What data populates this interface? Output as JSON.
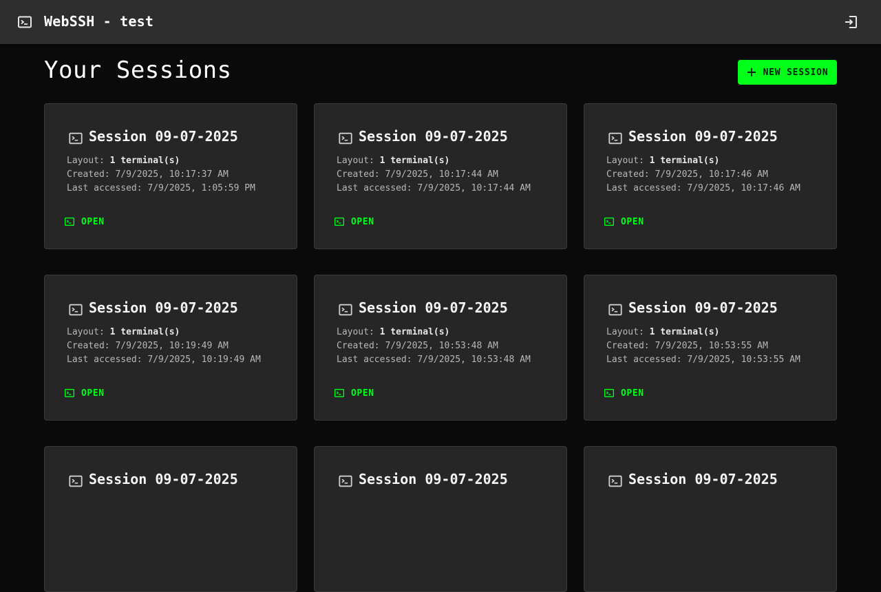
{
  "header": {
    "title": "WebSSH - test",
    "app_icon": "terminal-icon",
    "logout_icon": "logout-icon"
  },
  "page": {
    "title": "Your Sessions",
    "new_session_label": "NEW SESSION",
    "accent": "#00ff19"
  },
  "labels": {
    "layout": "Layout:",
    "created": "Created:",
    "last_accessed": "Last accessed:",
    "open": "OPEN"
  },
  "sessions": [
    {
      "title": "Session 09-07-2025",
      "layout_count": "1",
      "layout_unit": "terminal(s)",
      "created": "7/9/2025, 10:17:37 AM",
      "last_accessed": "7/9/2025, 1:05:59 PM"
    },
    {
      "title": "Session 09-07-2025",
      "layout_count": "1",
      "layout_unit": "terminal(s)",
      "created": "7/9/2025, 10:17:44 AM",
      "last_accessed": "7/9/2025, 10:17:44 AM"
    },
    {
      "title": "Session 09-07-2025",
      "layout_count": "1",
      "layout_unit": "terminal(s)",
      "created": "7/9/2025, 10:17:46 AM",
      "last_accessed": "7/9/2025, 10:17:46 AM"
    },
    {
      "title": "Session 09-07-2025",
      "layout_count": "1",
      "layout_unit": "terminal(s)",
      "created": "7/9/2025, 10:19:49 AM",
      "last_accessed": "7/9/2025, 10:19:49 AM"
    },
    {
      "title": "Session 09-07-2025",
      "layout_count": "1",
      "layout_unit": "terminal(s)",
      "created": "7/9/2025, 10:53:48 AM",
      "last_accessed": "7/9/2025, 10:53:48 AM"
    },
    {
      "title": "Session 09-07-2025",
      "layout_count": "1",
      "layout_unit": "terminal(s)",
      "created": "7/9/2025, 10:53:55 AM",
      "last_accessed": "7/9/2025, 10:53:55 AM"
    },
    {
      "title": "Session 09-07-2025"
    },
    {
      "title": "Session 09-07-2025"
    },
    {
      "title": "Session 09-07-2025"
    }
  ]
}
